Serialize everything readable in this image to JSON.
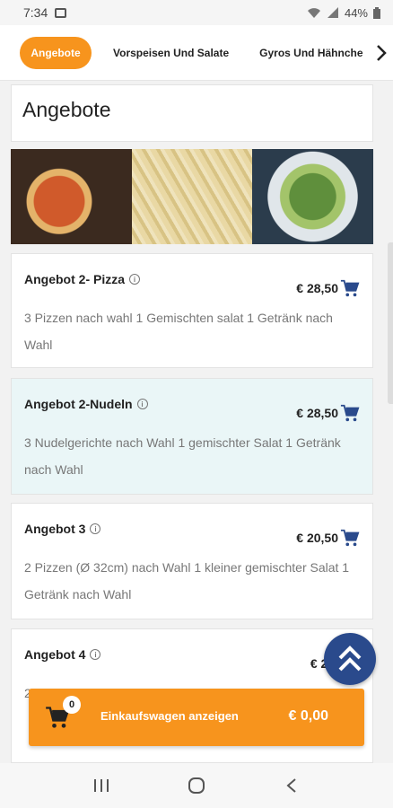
{
  "status": {
    "time": "7:34",
    "battery": "44%"
  },
  "tabs": [
    {
      "label": "Angebote",
      "active": true
    },
    {
      "label": "Vorspeisen Und Salate",
      "active": false
    },
    {
      "label": "Gyros Und Hähnche",
      "active": false
    }
  ],
  "page": {
    "heading": "Angebote"
  },
  "items": [
    {
      "title": "Angebot 2- Pizza",
      "price": "€ 28,50",
      "description": "3 Pizzen nach wahl 1 Gemischten salat 1 Getränk nach Wahl",
      "highlighted": false
    },
    {
      "title": "Angebot 2-Nudeln",
      "price": "€ 28,50",
      "description": "3 Nudelgerichte nach Wahl 1 gemischter Salat 1 Getränk nach Wahl",
      "highlighted": true
    },
    {
      "title": "Angebot 3",
      "price": "€ 20,50",
      "description": "2 Pizzen (Ø 32cm) nach Wahl 1 kleiner gemischter Salat 1 Getränk nach Wahl",
      "highlighted": false
    },
    {
      "title": "Angebot 4",
      "price": "€ 20,",
      "description": "2 ",
      "highlighted": false
    }
  ],
  "cart": {
    "count": "0",
    "label": "Einkaufswagen anzeigen",
    "total": "€ 0,00"
  },
  "colors": {
    "accent": "#f7941d",
    "highlight": "#eaf6f7",
    "cart_icon": "#2a4a8c"
  },
  "icons": {
    "info": "info-icon",
    "cart": "shopping-cart-icon",
    "scroll_top": "double-chevron-up-icon"
  }
}
